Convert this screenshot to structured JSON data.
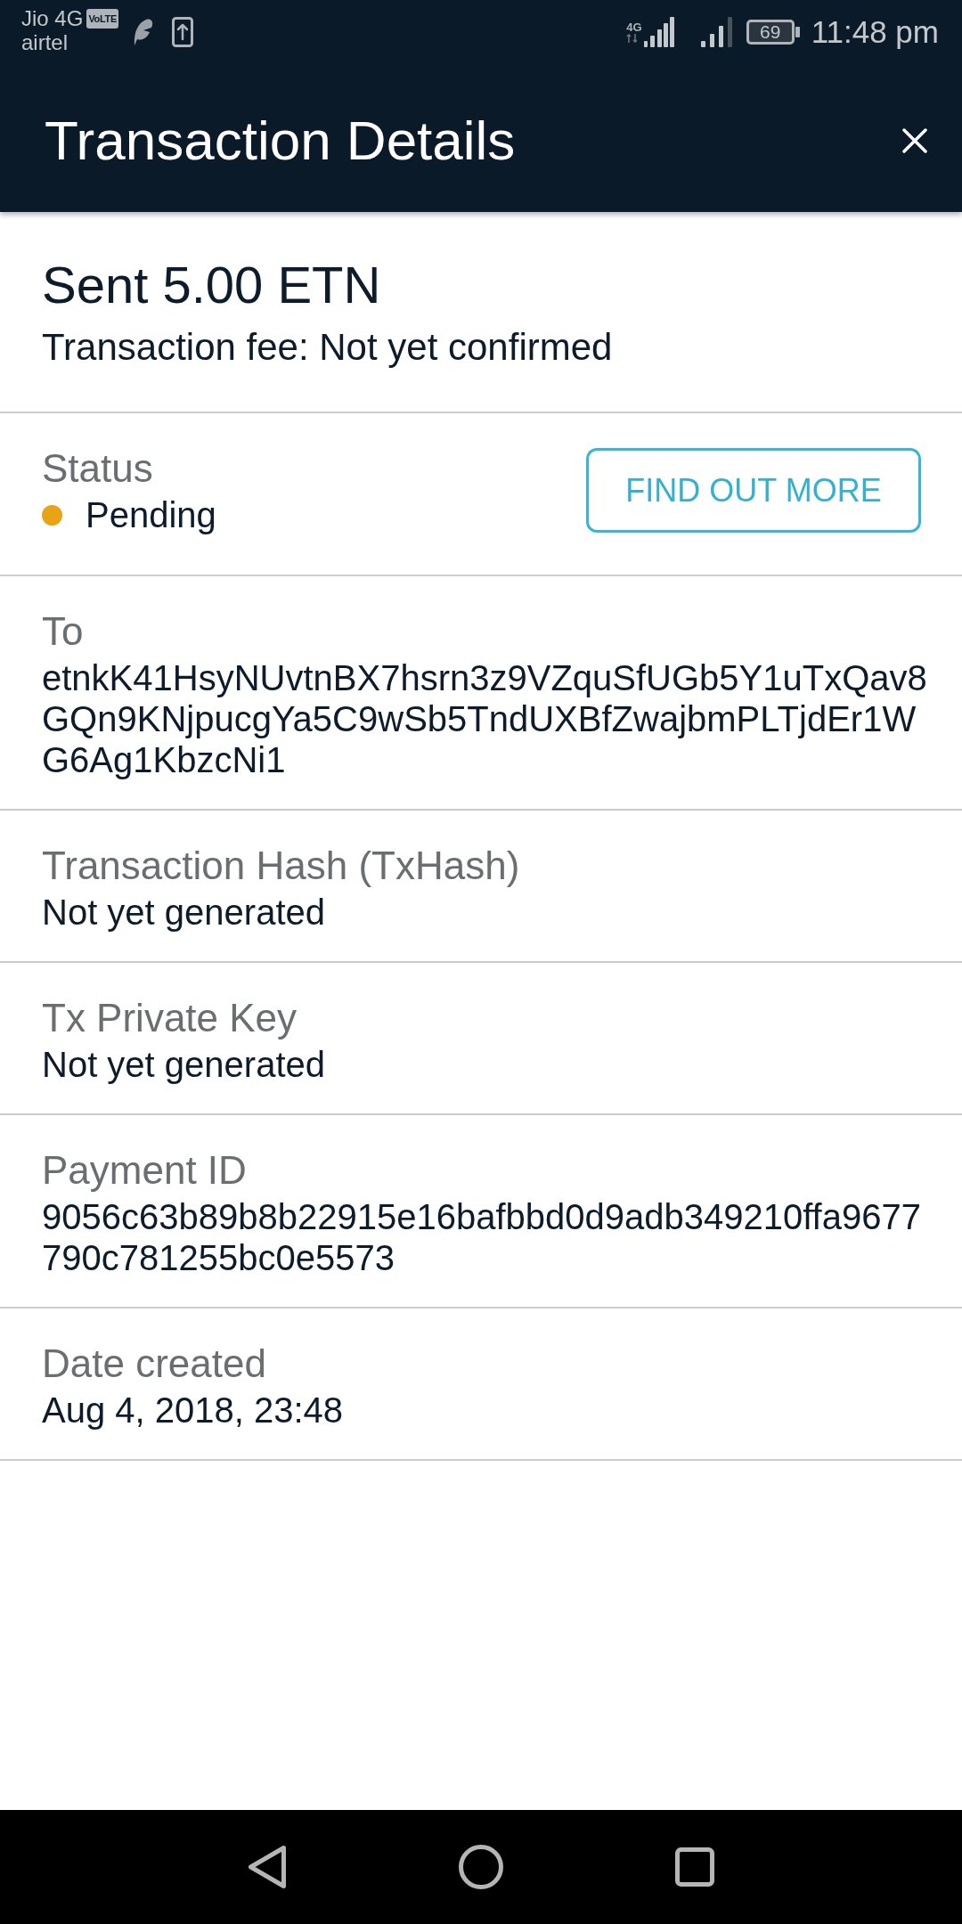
{
  "status_bar": {
    "carrier": "Jio 4G",
    "volte": "VoLTE",
    "carrier_2": "airtel",
    "network": "4G",
    "battery": "69",
    "time": "11:48 pm"
  },
  "app_bar": {
    "title": "Transaction Details"
  },
  "summary": {
    "amount": "Sent 5.00 ETN",
    "fee": "Transaction fee: Not yet confirmed"
  },
  "fields": [
    {
      "kind": "status",
      "label": "Status",
      "value": "Pending",
      "color": "#e8a317",
      "button": "FIND OUT MORE"
    },
    {
      "kind": "text",
      "label": "To",
      "value": "etnkK41HsyNUvtnBX7hsrn3z9VZquSfUGb5Y1uTxQav8GQn9KNjpucgYa5C9wSb5TndUXBfZwajbmPLTjdEr1WG6Ag1KbzcNi1"
    },
    {
      "kind": "text",
      "label": "Transaction Hash (TxHash)",
      "value": "Not yet generated"
    },
    {
      "kind": "text",
      "label": "Tx Private Key",
      "value": "Not yet generated"
    },
    {
      "kind": "text",
      "label": "Payment ID",
      "value": "9056c63b89b8b22915e16bafbbd0d9adb349210ffa9677790c781255bc0e5573"
    },
    {
      "kind": "text",
      "label": "Date created",
      "value": "Aug 4, 2018, 23:48"
    }
  ]
}
